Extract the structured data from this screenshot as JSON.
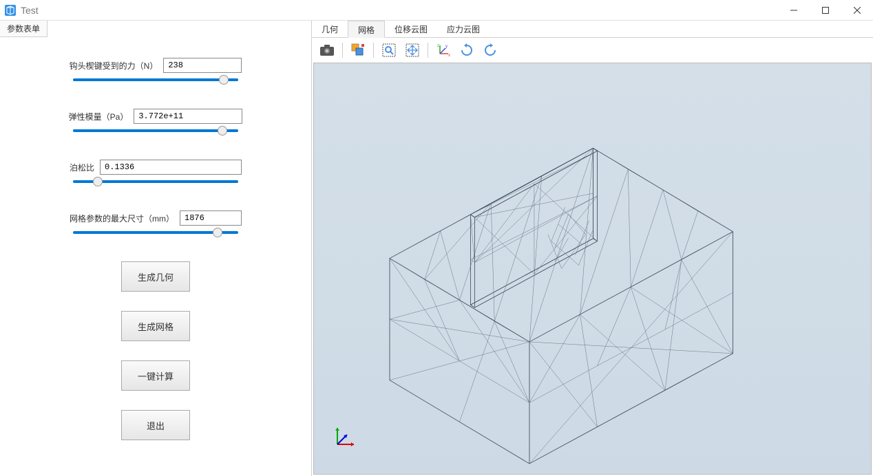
{
  "window": {
    "title": "Test"
  },
  "sidebar": {
    "tab_label": "参数表单",
    "params": {
      "force": {
        "label": "钩头楔键受到的力（N）",
        "value": "238",
        "slider": 94
      },
      "modulus": {
        "label": "弹性模量（Pa）",
        "value": "3.772e+11",
        "slider": 93
      },
      "poisson": {
        "label": "泊松比",
        "value": "0.1336",
        "slider": 13
      },
      "mesh_size": {
        "label": "网格参数的最大尺寸（mm）",
        "value": "1876",
        "slider": 90
      }
    },
    "buttons": {
      "gen_geom": "生成几何",
      "gen_mesh": "生成网格",
      "compute": "一键计算",
      "exit": "退出"
    }
  },
  "content": {
    "tabs": {
      "geometry": "几何",
      "mesh": "网格",
      "disp_cloud": "位移云图",
      "stress_cloud": "应力云图"
    },
    "active_tab": "mesh"
  }
}
